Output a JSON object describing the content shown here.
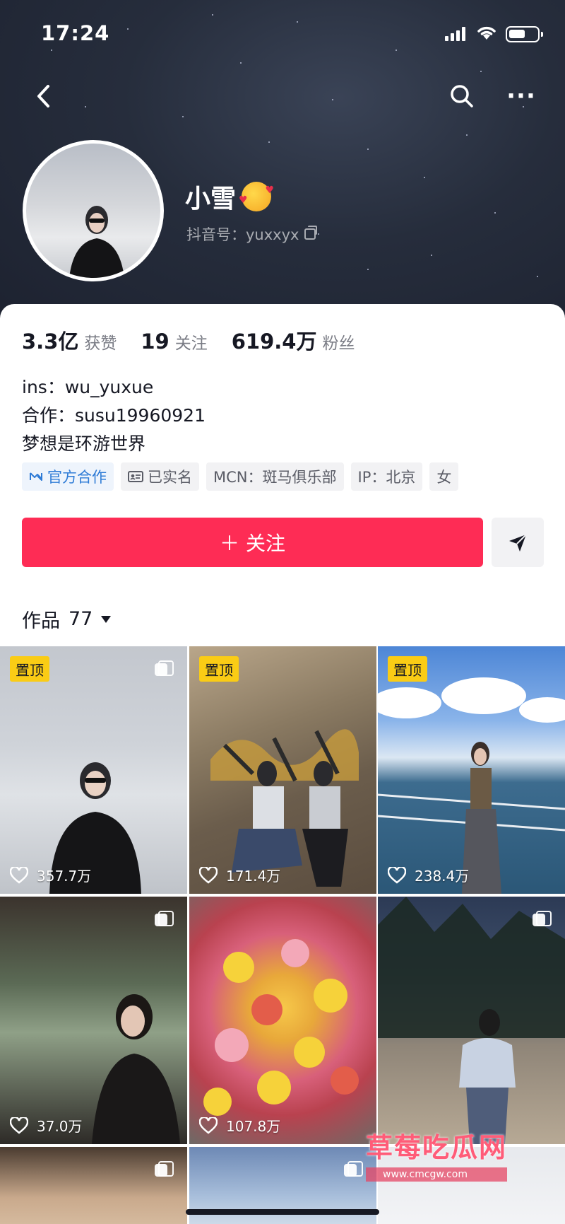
{
  "status_bar": {
    "time": "17:24"
  },
  "profile": {
    "nickname": "小雪",
    "douyin_id": "抖音号：yuxxyx"
  },
  "stats": [
    {
      "value": "3.3亿",
      "label": "获赞"
    },
    {
      "value": "19",
      "label": "关注"
    },
    {
      "value": "619.4万",
      "label": "粉丝"
    }
  ],
  "bio": [
    "ins：wu_yuxue",
    "合作：susu19960921",
    "梦想是环游世界"
  ],
  "tags": [
    {
      "label": "官方合作",
      "icon": "handshake-icon"
    },
    {
      "label": "已实名",
      "icon": "id-card-icon"
    },
    {
      "label": "MCN：斑马俱乐部"
    },
    {
      "label": "IP：北京"
    },
    {
      "label": "女"
    }
  ],
  "actions": {
    "follow_label": "＋ 关注"
  },
  "works": {
    "label": "作品",
    "count": "77"
  },
  "videos": [
    {
      "likes": "357.7万",
      "pinned": "置顶",
      "multi_image": true
    },
    {
      "likes": "171.4万",
      "pinned": "置顶",
      "multi_image": false
    },
    {
      "likes": "238.4万",
      "pinned": "置顶",
      "multi_image": false
    },
    {
      "likes": "37.0万",
      "multi_image": true
    },
    {
      "likes": "107.8万",
      "multi_image": false
    },
    {
      "likes": "",
      "multi_image": true
    },
    {
      "likes": "",
      "multi_image": true
    },
    {
      "likes": "",
      "multi_image": true
    },
    {
      "likes": "",
      "multi_image": false
    }
  ],
  "watermark": {
    "title": "草莓吃瓜网",
    "url": "www.cmcgw.com"
  },
  "colors": {
    "accent": "#fe2c55",
    "pin_badge": "#facc15",
    "official_blue": "#2e7bd6"
  }
}
